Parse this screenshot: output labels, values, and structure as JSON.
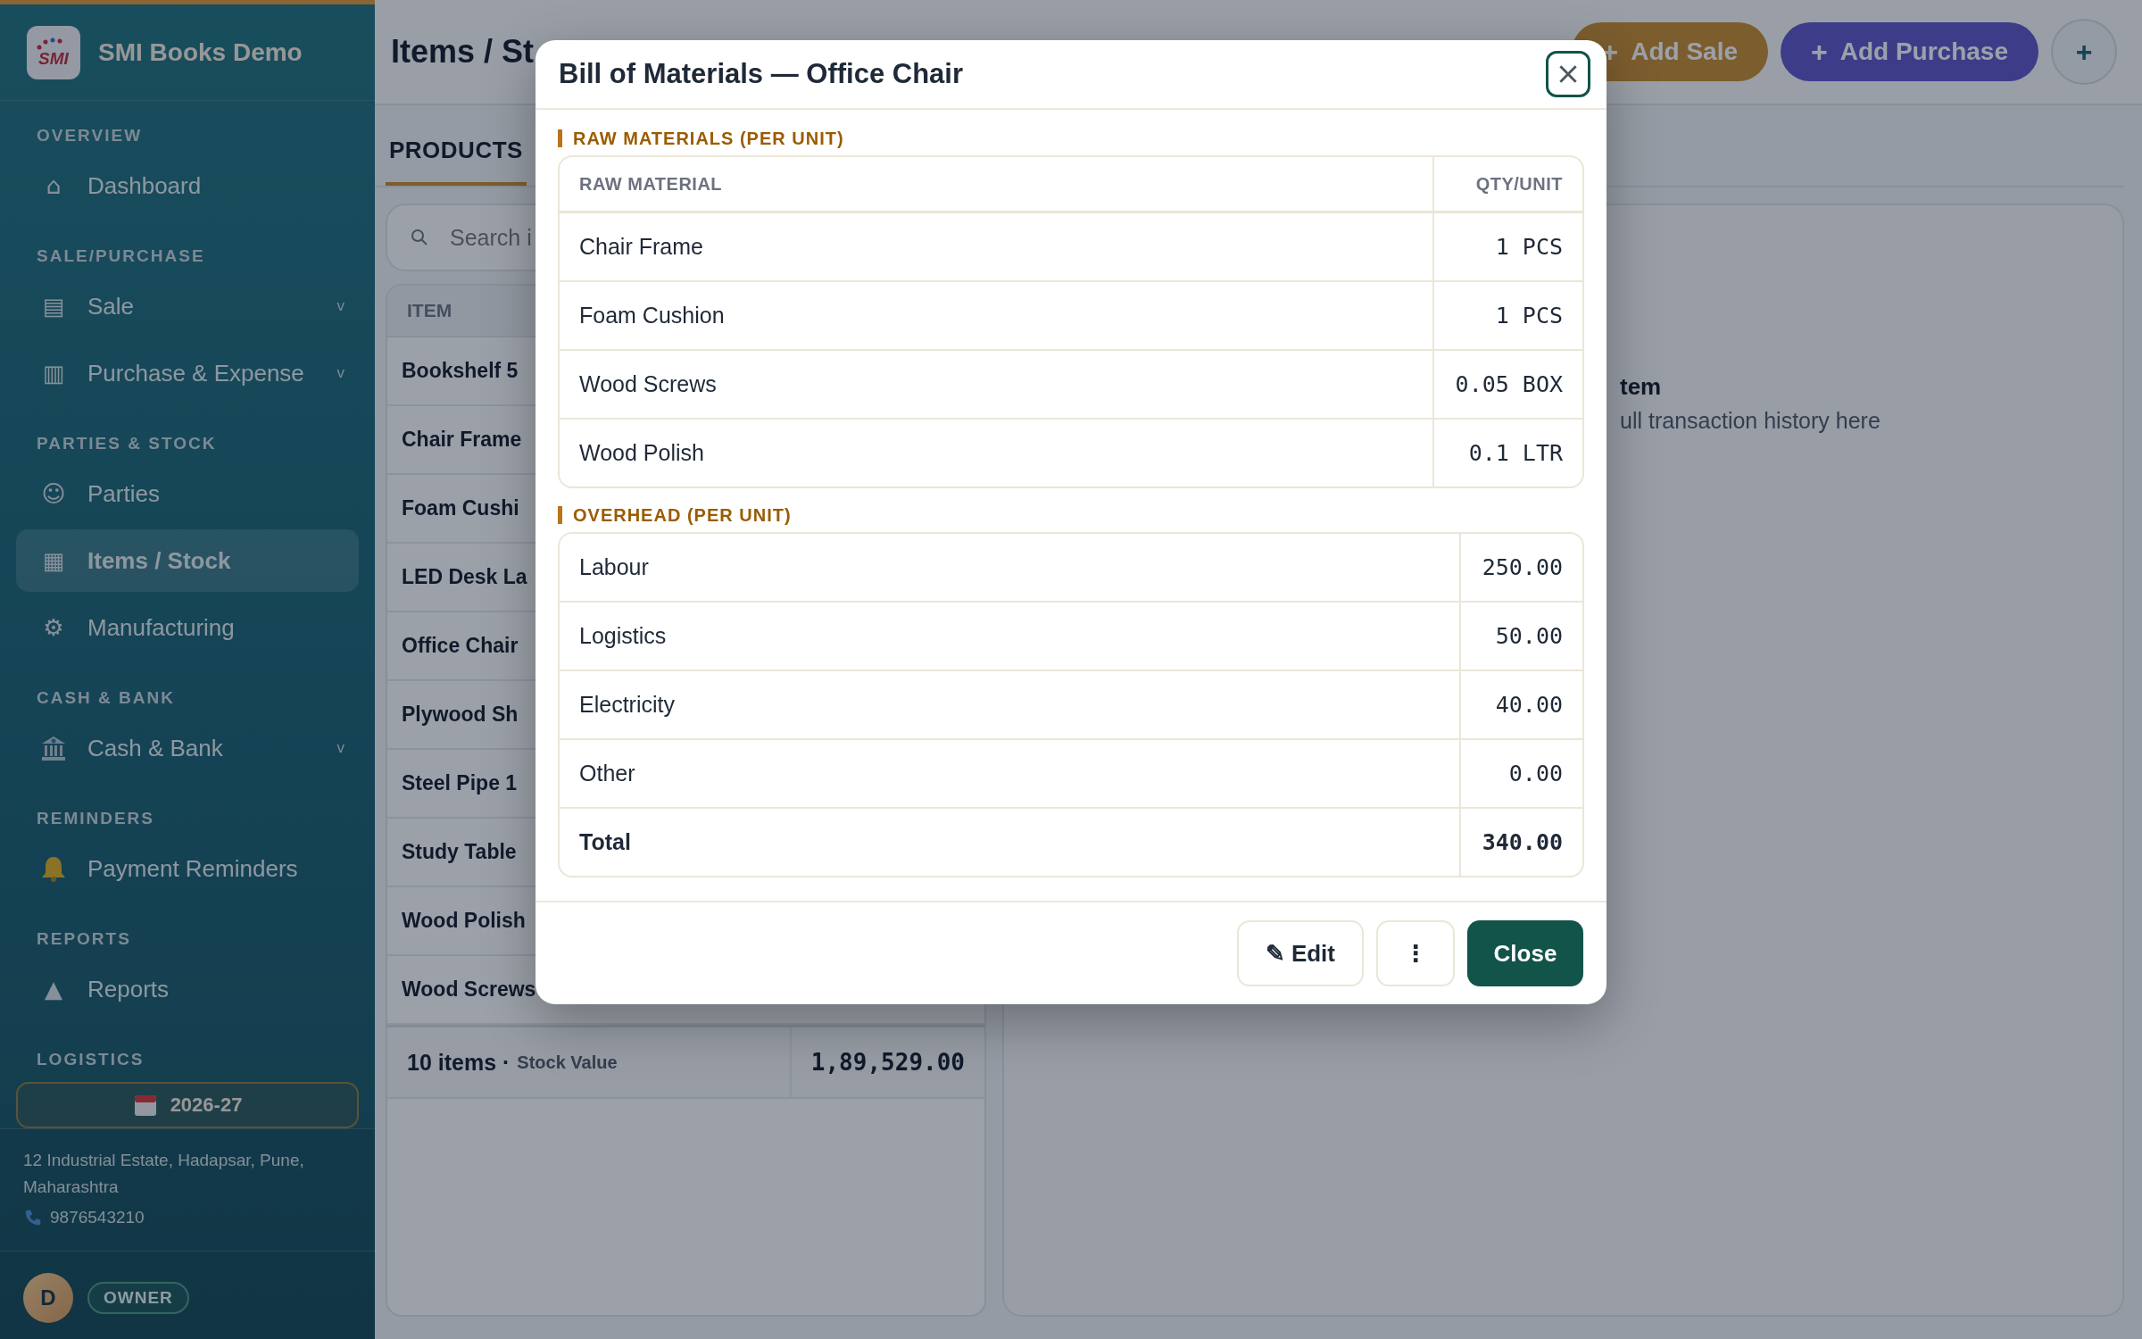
{
  "app": {
    "name": "SMI Books Demo",
    "logo_text": "SMI"
  },
  "sidebar": {
    "sections": [
      {
        "title": "OVERVIEW",
        "items": [
          {
            "kind": "glyph",
            "icon": "⌂",
            "label": "Dashboard",
            "selected": false
          }
        ]
      },
      {
        "title": "SALE/PURCHASE",
        "items": [
          {
            "kind": "glyph",
            "icon": "▤",
            "label": "Sale",
            "chevron": "v",
            "selected": false
          },
          {
            "kind": "glyph",
            "icon": "▥",
            "label": "Purchase & Expense",
            "chevron": "v",
            "selected": false
          }
        ]
      },
      {
        "title": "PARTIES & STOCK",
        "items": [
          {
            "kind": "glyph",
            "icon": "☺",
            "label": "Parties",
            "selected": false
          },
          {
            "kind": "glyph",
            "icon": "▦",
            "label": "Items / Stock",
            "selected": true
          },
          {
            "kind": "glyph",
            "icon": "⚙",
            "label": "Manufacturing",
            "selected": false
          }
        ]
      },
      {
        "title": "CASH & BANK",
        "items": [
          {
            "kind": "bank",
            "label": "Cash & Bank",
            "chevron": "v",
            "selected": false
          }
        ]
      },
      {
        "title": "REMINDERS",
        "items": [
          {
            "kind": "bell",
            "label": "Payment Reminders",
            "selected": false
          }
        ]
      },
      {
        "title": "REPORTS",
        "items": [
          {
            "kind": "glyph",
            "icon": "▲",
            "label": "Reports",
            "selected": false
          }
        ]
      },
      {
        "title": "LOGISTICS"
      }
    ],
    "year": "2026-27",
    "address": "12 Industrial Estate, Hadapsar, Pune, Maharashtra",
    "phone": "9876543210",
    "user": {
      "initial": "D",
      "role": "OWNER"
    }
  },
  "header": {
    "title": "Items / St",
    "actions": [
      {
        "kind": "sale",
        "icon": "+",
        "label": "Add Sale"
      },
      {
        "kind": "purchase",
        "icon": "+",
        "label": "Add Purchase"
      },
      {
        "kind": "round",
        "icon": "+"
      }
    ]
  },
  "tabs": [
    {
      "label": "PRODUCTS",
      "selected": true
    }
  ],
  "search": {
    "placeholder": "Search i"
  },
  "items_table": {
    "column": "ITEM",
    "rows": [
      "Bookshelf 5",
      "Chair Frame",
      "Foam Cushi",
      "LED Desk La",
      "Office Chair",
      "Plywood Sh",
      "Steel Pipe 1",
      "Study Table",
      "Wood Polish",
      "Wood Screws"
    ],
    "footer": {
      "count": "10 items ·",
      "label": "Stock Value",
      "value": "1,89,529.00"
    }
  },
  "detail_panel": {
    "title": "tem",
    "subtitle": "ull transaction history here"
  },
  "modal": {
    "title": "Bill of Materials — Office Chair",
    "raw_materials": {
      "title": "RAW MATERIALS (PER UNIT)",
      "columns": [
        "RAW MATERIAL",
        "QTY/UNIT"
      ],
      "rows": [
        {
          "name": "Chair Frame",
          "qty": "1 PCS"
        },
        {
          "name": "Foam Cushion",
          "qty": "1 PCS"
        },
        {
          "name": "Wood Screws",
          "qty": "0.05 BOX"
        },
        {
          "name": "Wood Polish",
          "qty": "0.1 LTR"
        }
      ]
    },
    "overhead": {
      "title": "OVERHEAD (PER UNIT)",
      "rows": [
        {
          "name": "Labour",
          "amount": "250.00",
          "total": false
        },
        {
          "name": "Logistics",
          "amount": "50.00",
          "total": false
        },
        {
          "name": "Electricity",
          "amount": "40.00",
          "total": false
        },
        {
          "name": "Other",
          "amount": "0.00",
          "total": false
        },
        {
          "name": "Total",
          "amount": "340.00",
          "total": true
        }
      ]
    },
    "buttons": {
      "edit_icon": "✎",
      "edit": "Edit",
      "more": "⋮",
      "close": "Close"
    }
  }
}
